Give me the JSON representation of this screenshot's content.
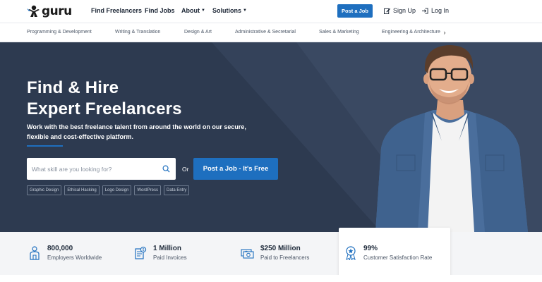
{
  "nav": {
    "logo_text": "guru",
    "links": [
      "Find Freelancers",
      "Find Jobs",
      "About",
      "Solutions"
    ],
    "post_job": "Post a Job",
    "sign_up": "Sign Up",
    "log_in": "Log In"
  },
  "categories": [
    "Programming & Development",
    "Writing & Translation",
    "Design & Art",
    "Administrative & Secretarial",
    "Sales & Marketing",
    "Engineering & Architecture"
  ],
  "hero": {
    "title_line1": "Find & Hire",
    "title_line2": "Expert Freelancers",
    "subtitle": "Work with the best freelance talent from around the world on our secure, flexible and cost-effective platform.",
    "search_placeholder": "What skill are you looking for?",
    "or": "Or",
    "post_button": "Post a Job - It's Free",
    "tags": [
      "Graphic Design",
      "Ethical Hacking",
      "Logo Design",
      "WordPress",
      "Data Entry"
    ]
  },
  "stats": [
    {
      "value": "800,000",
      "label": "Employers Worldwide",
      "icon": "person-icon"
    },
    {
      "value": "1 Million",
      "label": "Paid Invoices",
      "icon": "invoice-icon"
    },
    {
      "value": "$250 Million",
      "label": "Paid to Freelancers",
      "icon": "money-icon"
    },
    {
      "value": "99%",
      "label": "Customer Satisfaction Rate",
      "icon": "award-icon"
    }
  ],
  "colors": {
    "brand_blue": "#1e6fbf",
    "hero_dark": "#2d3a50",
    "stats_bg": "#f4f5f7"
  }
}
